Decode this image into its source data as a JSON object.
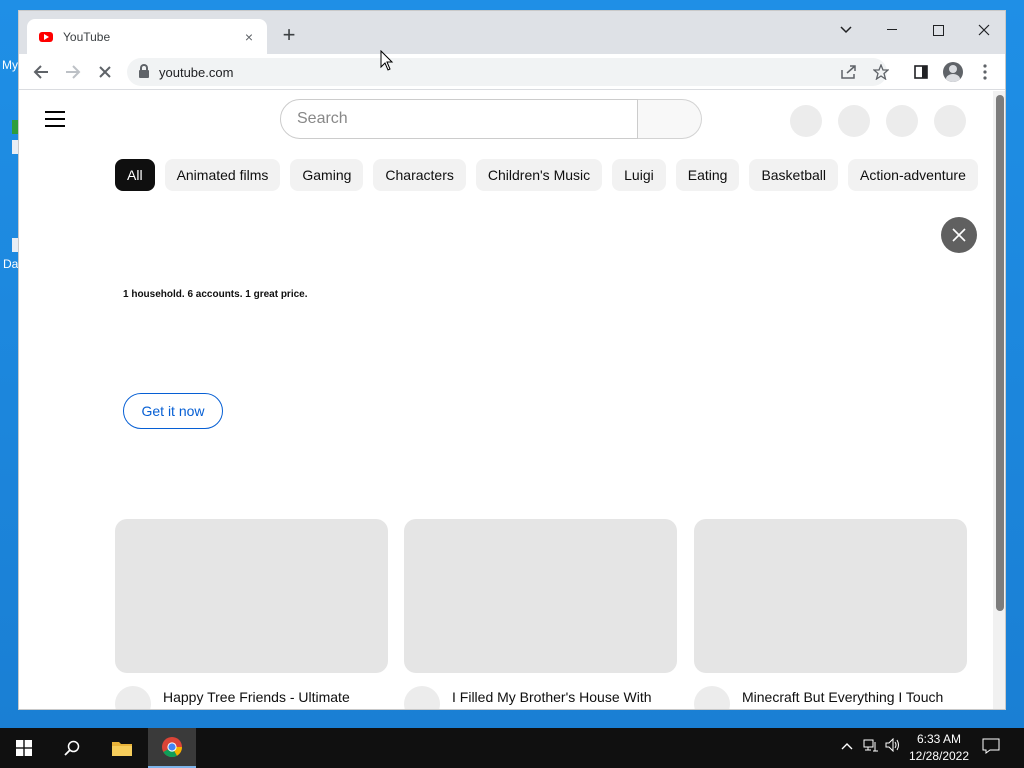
{
  "desktop": {
    "icon_labels": [
      "My",
      "Da"
    ]
  },
  "browser": {
    "tab": {
      "title": "YouTube",
      "close_glyph": "×"
    },
    "new_tab_glyph": "+",
    "url": "youtube.com"
  },
  "youtube": {
    "search": {
      "placeholder": "Search"
    },
    "chips": [
      "All",
      "Animated films",
      "Gaming",
      "Characters",
      "Children's Music",
      "Luigi",
      "Eating",
      "Basketball",
      "Action-adventure"
    ],
    "promo": {
      "tagline": "1 household. 6 accounts. 1 great price.",
      "cta": "Get it now"
    },
    "videos": [
      {
        "title": "Happy Tree Friends - Ultimate"
      },
      {
        "title": "I Filled My Brother's House With"
      },
      {
        "title": "Minecraft But Everything I Touch"
      }
    ]
  },
  "taskbar": {
    "time": "6:33 AM",
    "date": "12/28/2022"
  },
  "colors": {
    "desktop_bg": "#1a8ee0",
    "youtube_red": "#ff0000",
    "link_blue": "#065fd4"
  }
}
